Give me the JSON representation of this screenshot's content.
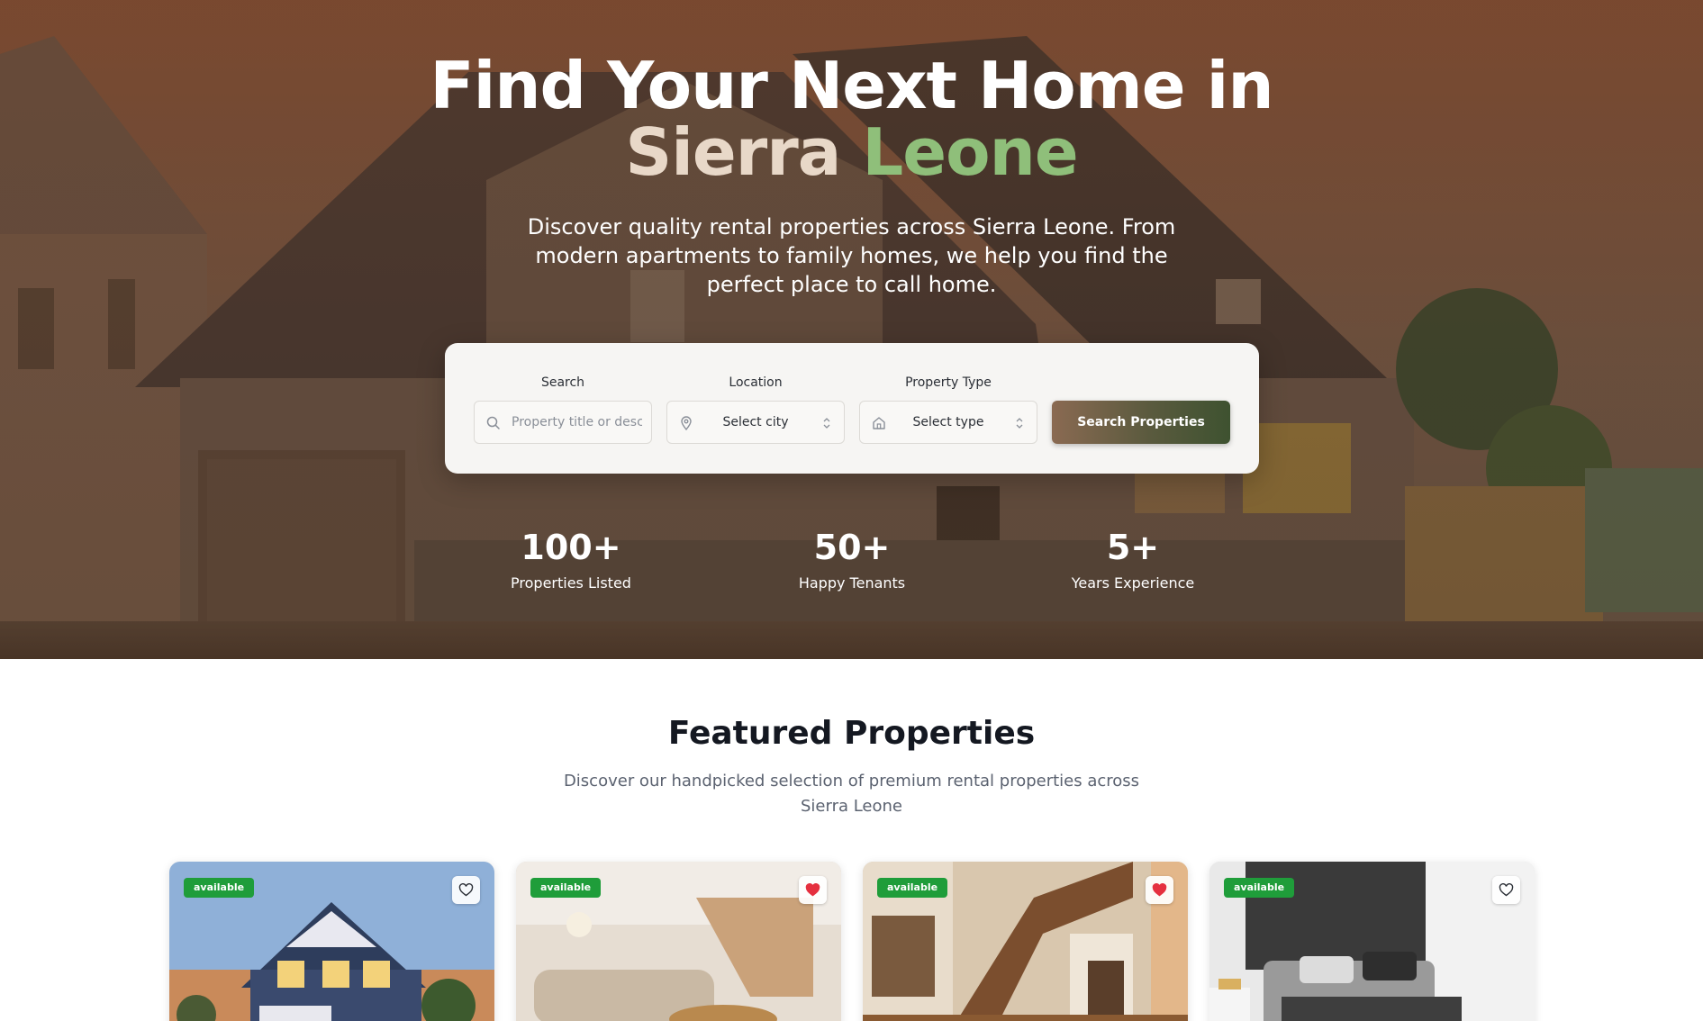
{
  "hero": {
    "title_line1": "Find Your Next Home in",
    "title_word1": "Sierra",
    "title_word2": "Leone",
    "subtitle": "Discover quality rental properties across Sierra Leone. From modern apartments to family homes, we help you find the perfect place to call home.",
    "colors": {
      "title_word1": "#e8d8c8",
      "title_word2": "#8fbf7a"
    }
  },
  "search": {
    "search_label": "Search",
    "search_placeholder": "Property title or description",
    "location_label": "Location",
    "location_value": "Select city",
    "type_label": "Property Type",
    "type_value": "Select type",
    "button_label": "Search Properties",
    "icons": [
      "search-icon",
      "map-pin-icon",
      "home-icon",
      "chevron-updown-icon"
    ]
  },
  "stats": [
    {
      "value": "100+",
      "label": "Properties Listed"
    },
    {
      "value": "50+",
      "label": "Happy Tenants"
    },
    {
      "value": "5+",
      "label": "Years Experience"
    }
  ],
  "featured": {
    "title": "Featured Properties",
    "subtitle": "Discover our handpicked selection of premium rental properties across Sierra Leone",
    "cards": [
      {
        "status": "available",
        "favorited": false
      },
      {
        "status": "available",
        "favorited": true
      },
      {
        "status": "available",
        "favorited": true
      },
      {
        "status": "available",
        "favorited": false
      }
    ],
    "colors": {
      "badge": "#1f9d3a",
      "heart_active": "#e5303f"
    }
  }
}
